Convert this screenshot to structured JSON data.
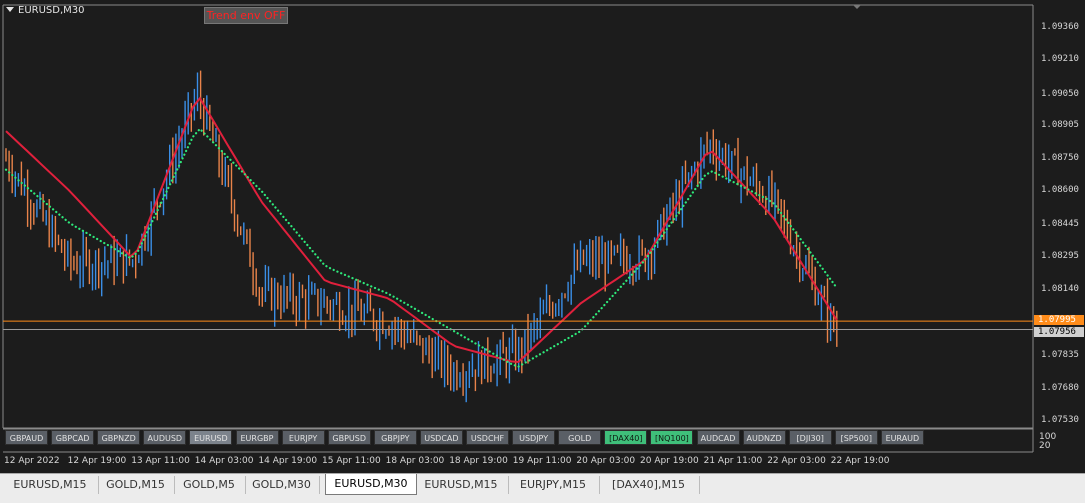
{
  "window": {
    "symbol_title": "EURUSD,M30",
    "trend_label": "Trend env OFF"
  },
  "price_axis": {
    "labels": [
      "1.09360",
      "1.09210",
      "1.09050",
      "1.08905",
      "1.08750",
      "1.08600",
      "1.08445",
      "1.08295",
      "1.08140",
      "1.07985",
      "1.07835",
      "1.07680",
      "1.07530"
    ],
    "current_price": "1.07956",
    "hline_price": "1.07995",
    "hline_color": "#ff8c1a",
    "current_color": "#d0d0d0"
  },
  "indicator_axis": {
    "labels": [
      "100",
      "20"
    ]
  },
  "symbol_buttons": [
    {
      "label": "GBPAUD",
      "state": "normal"
    },
    {
      "label": "GBPCAD",
      "state": "normal"
    },
    {
      "label": "GBPNZD",
      "state": "normal"
    },
    {
      "label": "AUDUSD",
      "state": "normal"
    },
    {
      "label": "EURUSD",
      "state": "active"
    },
    {
      "label": "EURGBP",
      "state": "normal"
    },
    {
      "label": "EURJPY",
      "state": "normal"
    },
    {
      "label": "GBPUSD",
      "state": "normal"
    },
    {
      "label": "GBPJPY",
      "state": "normal"
    },
    {
      "label": "USDCAD",
      "state": "normal"
    },
    {
      "label": "USDCHF",
      "state": "normal"
    },
    {
      "label": "USDJPY",
      "state": "normal"
    },
    {
      "label": "GOLD",
      "state": "normal"
    },
    {
      "label": "[DAX40]",
      "state": "green"
    },
    {
      "label": "[NQ100]",
      "state": "green"
    },
    {
      "label": "AUDCAD",
      "state": "normal"
    },
    {
      "label": "AUDNZD",
      "state": "normal"
    },
    {
      "label": "[DJI30]",
      "state": "normal"
    },
    {
      "label": "[SP500]",
      "state": "normal"
    },
    {
      "label": "EURAUD",
      "state": "normal"
    }
  ],
  "time_axis": [
    "12 Apr 2022",
    "12 Apr 19:00",
    "13 Apr 11:00",
    "14 Apr 03:00",
    "14 Apr 19:00",
    "15 Apr 11:00",
    "18 Apr 03:00",
    "18 Apr 19:00",
    "19 Apr 11:00",
    "20 Apr 03:00",
    "20 Apr 19:00",
    "21 Apr 11:00",
    "22 Apr 03:00",
    "22 Apr 19:00"
  ],
  "tabs": [
    {
      "label": "EURUSD,M15",
      "active": false
    },
    {
      "label": "GOLD,M15",
      "active": false
    },
    {
      "label": "GOLD,M5",
      "active": false
    },
    {
      "label": "GOLD,M30",
      "active": false
    },
    {
      "label": "EURUSD,M30",
      "active": true
    },
    {
      "label": "EURUSD,M15",
      "active": false
    },
    {
      "label": "EURJPY,M15",
      "active": false
    },
    {
      "label": "[DAX40],M15",
      "active": false
    }
  ],
  "colors": {
    "bull_candle": "#3a8ee6",
    "bear_candle": "#e8834a",
    "envelope_red": "#e0203c",
    "envelope_green": "#2ee87a"
  },
  "chart_data": {
    "type": "line",
    "title": "EURUSD,M30",
    "ylim": [
      1.0747,
      1.0945
    ],
    "x": [
      "12 Apr 2022",
      "12 Apr 19:00",
      "13 Apr 11:00",
      "14 Apr 03:00",
      "14 Apr 19:00",
      "15 Apr 11:00",
      "18 Apr 03:00",
      "18 Apr 19:00",
      "19 Apr 11:00",
      "20 Apr 03:00",
      "20 Apr 19:00",
      "21 Apr 11:00",
      "22 Apr 03:00",
      "22 Apr 19:00"
    ],
    "series": [
      {
        "values": [
          1.0875,
          1.0826,
          1.0828,
          1.0905,
          1.0812,
          1.0808,
          1.0799,
          1.0776,
          1.0784,
          1.0827,
          1.0829,
          1.0882,
          1.0855,
          1.0794
        ]
      },
      {
        "values": [
          1.0888,
          1.086,
          1.0828,
          1.0905,
          1.0855,
          1.0818,
          1.081,
          1.0788,
          1.078,
          1.0808,
          1.0828,
          1.088,
          1.0848,
          1.08
        ]
      },
      {
        "values": [
          1.087,
          1.0845,
          1.0828,
          1.089,
          1.086,
          1.0825,
          1.0812,
          1.0795,
          1.0778,
          1.0795,
          1.0828,
          1.087,
          1.0855,
          1.0815
        ]
      }
    ]
  }
}
